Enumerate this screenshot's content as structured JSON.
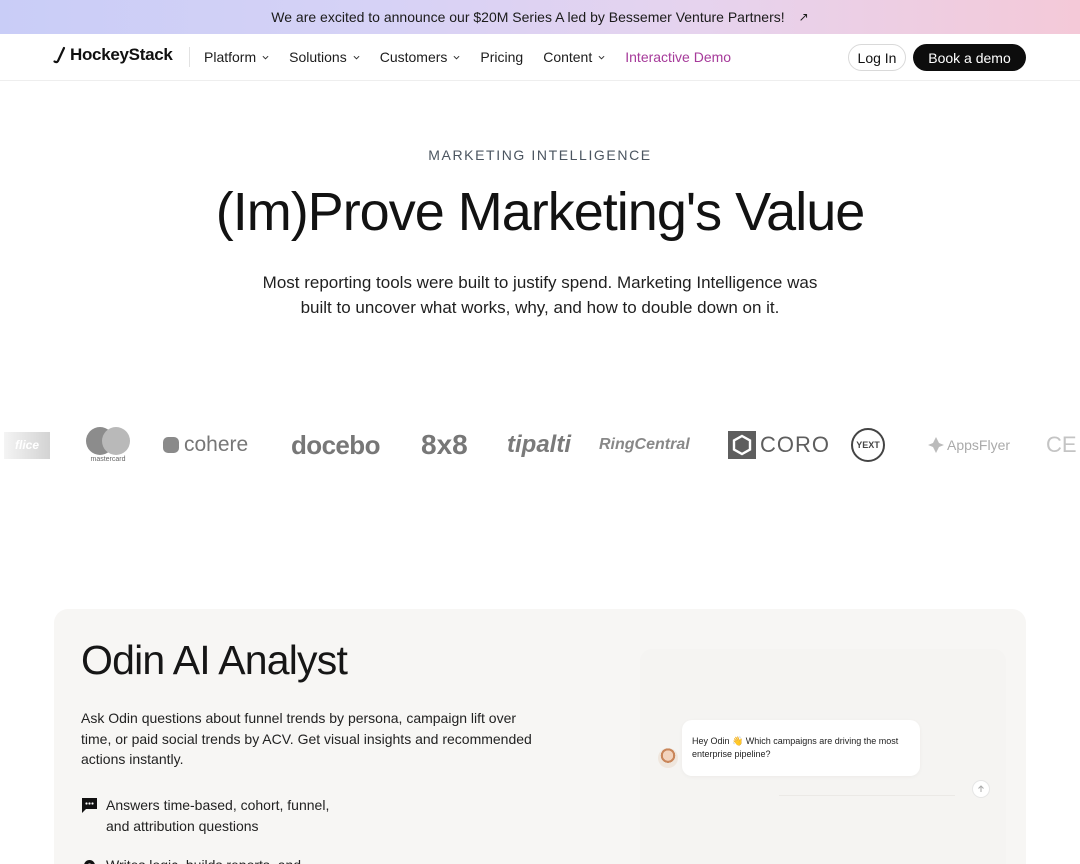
{
  "announcement": {
    "text": "We are excited to announce our $20M Series A led by Bessemer Venture Partners!",
    "arrow": "↗"
  },
  "nav": {
    "brand": "HockeyStack",
    "items": [
      {
        "label": "Platform",
        "dropdown": true
      },
      {
        "label": "Solutions",
        "dropdown": true
      },
      {
        "label": "Customers",
        "dropdown": true
      },
      {
        "label": "Pricing",
        "dropdown": false
      },
      {
        "label": "Content",
        "dropdown": true
      },
      {
        "label": "Interactive Demo",
        "dropdown": false
      }
    ],
    "login": "Log In",
    "cta": "Book a demo"
  },
  "hero": {
    "eyebrow": "MARKETING INTELLIGENCE",
    "title": "(Im)Prove Marketing's Value",
    "subtitle": "Most reporting tools were built to justify spend. Marketing Intelligence was built to uncover what works, why, and how to double down on it."
  },
  "logos": [
    {
      "name": "flice",
      "text": "flice"
    },
    {
      "name": "mastercard",
      "text": "mastercard"
    },
    {
      "name": "cohere",
      "text": "cohere"
    },
    {
      "name": "docebo",
      "text": "docebo"
    },
    {
      "name": "8x8",
      "text": "8x8"
    },
    {
      "name": "tipalti",
      "text": "tipalti"
    },
    {
      "name": "ringcentral",
      "text": "RingCentral"
    },
    {
      "name": "coro",
      "text": "CORO"
    },
    {
      "name": "yext",
      "text": "YEXT"
    },
    {
      "name": "appsflyer",
      "text": "AppsFlyer"
    },
    {
      "name": "ce",
      "text": "CE"
    }
  ],
  "odin": {
    "title": "Odin AI Analyst",
    "description": "Ask Odin questions about funnel trends by persona, campaign lift over time, or paid social trends by ACV. Get visual insights and recommended actions instantly.",
    "features": [
      {
        "icon": "chat-icon",
        "text": "Answers time-based, cohort, funnel, and attribution questions"
      },
      {
        "icon": "gear-icon",
        "text": "Writes logic, builds reports, and"
      }
    ],
    "chat_message": "Hey Odin 👋 Which campaigns are driving the most enterprise pipeline?"
  },
  "colors": {
    "accent_demo": "#a63a9a",
    "cta_bg": "#0d0d0d",
    "card_bg": "#f7f6f4"
  }
}
